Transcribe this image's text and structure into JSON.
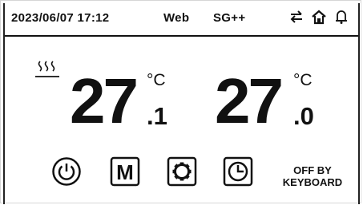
{
  "status_bar": {
    "datetime": "2023/06/07 17:12",
    "network": "Web",
    "protocol": "SG++",
    "icons": [
      "transfer-arrows-icon",
      "home-icon",
      "bell-icon"
    ]
  },
  "heating_indicator": {
    "icon": "heat-waves-icon"
  },
  "temperatures": [
    {
      "integer": "27",
      "decimal": ".1",
      "unit": "°C"
    },
    {
      "integer": "27",
      "decimal": ".0",
      "unit": "°C"
    }
  ],
  "buttons": [
    {
      "name": "power",
      "icon": "power-icon"
    },
    {
      "name": "mode",
      "icon": "mode-m-icon",
      "label": "M"
    },
    {
      "name": "settings",
      "icon": "gear-icon"
    },
    {
      "name": "timer",
      "icon": "clock-icon"
    }
  ],
  "status_message": {
    "line1": "OFF BY",
    "line2": "KEYBOARD"
  },
  "colors": {
    "foreground": "#111111",
    "background": "#ffffff"
  }
}
